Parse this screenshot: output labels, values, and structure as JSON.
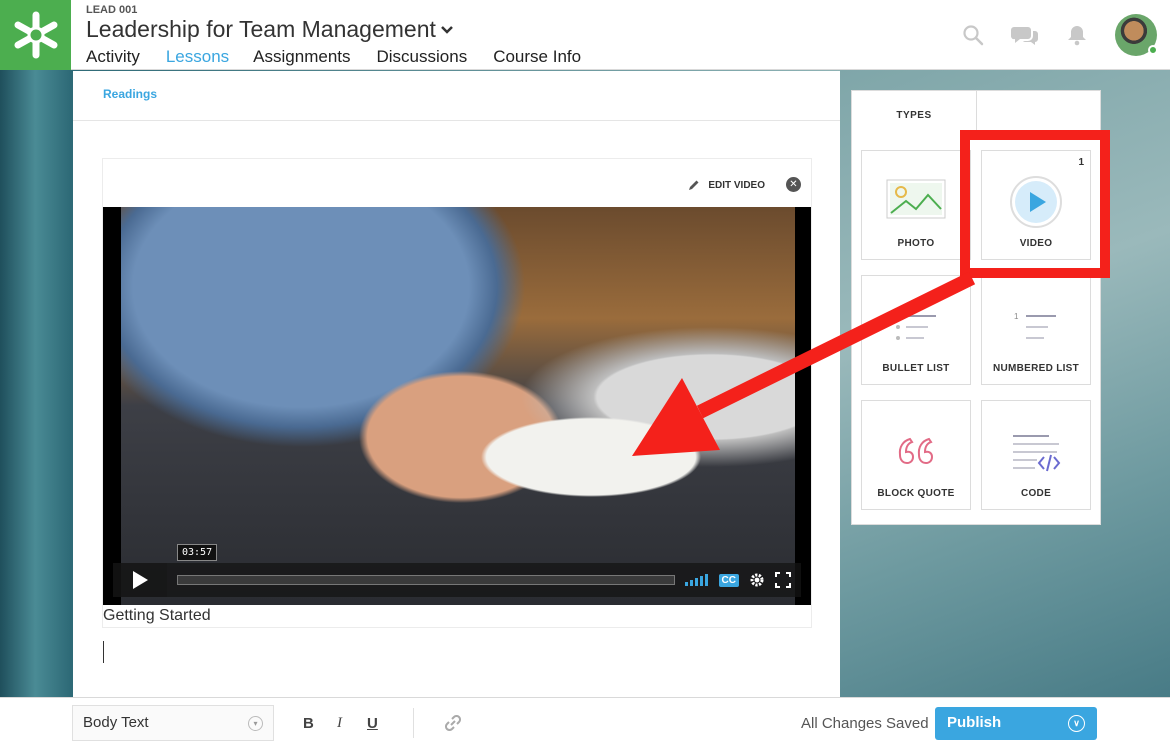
{
  "header": {
    "course_code": "LEAD 001",
    "course_title": "Leadership for Team Management",
    "tabs": [
      {
        "label": "Activity"
      },
      {
        "label": "Lessons"
      },
      {
        "label": "Assignments"
      },
      {
        "label": "Discussions"
      },
      {
        "label": "Course Info"
      }
    ],
    "active_tab": "Lessons",
    "icons": [
      "search-icon",
      "chat-icon",
      "bell-icon",
      "avatar"
    ]
  },
  "editor": {
    "breadcrumb": "Readings",
    "edit_video_label": "EDIT VIDEO",
    "video": {
      "time": "03:57",
      "cc_label": "CC",
      "caption": "Getting Started"
    }
  },
  "types_panel": {
    "header": "TYPES",
    "items": [
      {
        "label": "PHOTO",
        "icon": "photo-icon"
      },
      {
        "label": "VIDEO",
        "icon": "video-play-icon",
        "count": "1"
      },
      {
        "label": "BULLET LIST",
        "icon": "bullet-list-icon"
      },
      {
        "label": "NUMBERED LIST",
        "icon": "numbered-list-icon"
      },
      {
        "label": "BLOCK QUOTE",
        "icon": "quote-icon"
      },
      {
        "label": "CODE",
        "icon": "code-icon"
      }
    ]
  },
  "toolbar": {
    "text_style": "Body Text",
    "bold_label": "B",
    "italic_label": "I",
    "underline_label": "U",
    "status": "All Changes Saved",
    "publish_label": "Publish"
  },
  "colors": {
    "brand_green": "#4cae4f",
    "accent_blue": "#3aa6e0",
    "annotation_red": "#f4211b"
  }
}
